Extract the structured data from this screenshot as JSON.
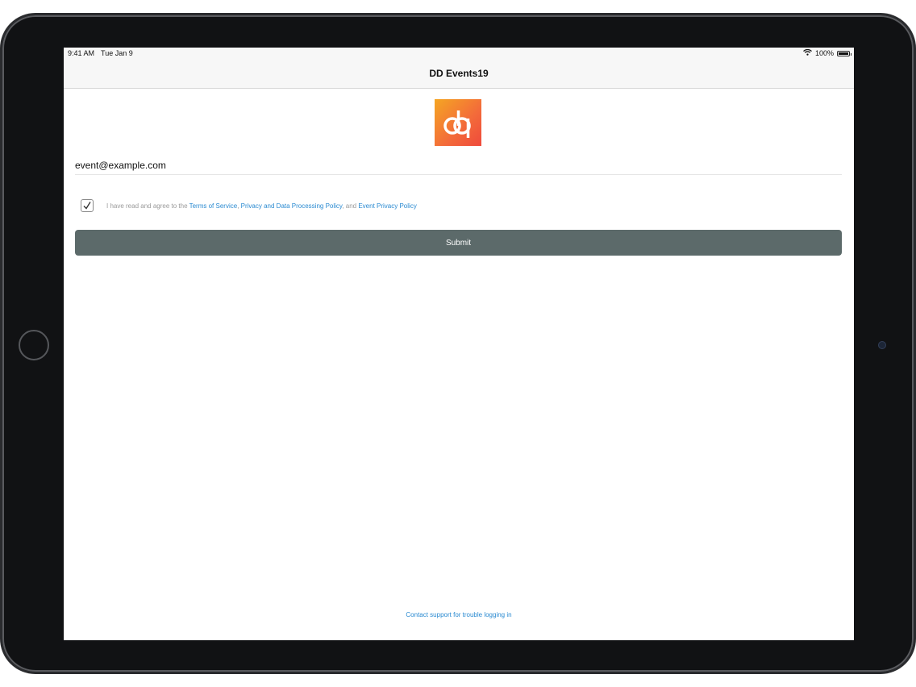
{
  "status_bar": {
    "time": "9:41 AM",
    "date": "Tue Jan 9",
    "battery": "100%",
    "icons": [
      "wifi-icon",
      "battery-icon"
    ]
  },
  "nav": {
    "title": "DD Events19"
  },
  "logo": {
    "icon": "dd-logo-icon",
    "colors": [
      "#f5a623",
      "#ef4a3c"
    ]
  },
  "email": {
    "value": "event@example.com"
  },
  "terms": {
    "checked": true,
    "prefix": "I have read and agree to the ",
    "terms_link": "Terms of Service",
    "sep1": ", ",
    "privacy_link": "Privacy and Data Processing Policy",
    "sep2": ", and ",
    "event_link": "Event Privacy Policy"
  },
  "submit": {
    "label": "Submit",
    "color": "#5c6a6a"
  },
  "support": {
    "label": "Contact support for trouble logging in"
  },
  "colors": {
    "link": "#2a8ad1"
  }
}
